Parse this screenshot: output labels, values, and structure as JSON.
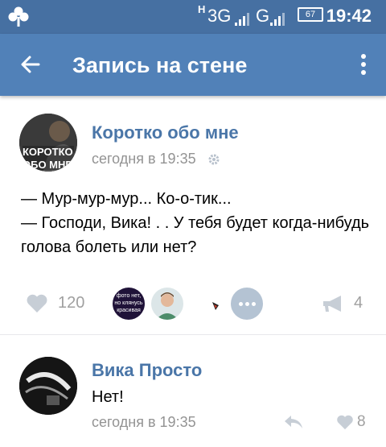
{
  "statusbar": {
    "network_h": "H",
    "network_3g": "3G",
    "network_g": "G",
    "battery": "67",
    "time": "19:42"
  },
  "appbar": {
    "title": "Запись на стене"
  },
  "post": {
    "author": "Коротко обо мне",
    "avatar_text_line1": "КОРОТКО",
    "avatar_text_line2": "ОБО МНЕ",
    "time": "сегодня в 19:35",
    "lines": [
      "— Мур-мур-мур... Ко-о-тик...",
      "— Господи, Вика! . . У тебя будет когда-нибудь",
      "голова болеть или нет?"
    ],
    "likes": "120",
    "shares": "4",
    "likers_badge_text": [
      "фото нет,",
      "но клянусь",
      "красивая"
    ]
  },
  "comment": {
    "author": "Вика Просто",
    "text": "Нет!",
    "time": "сегодня в 19:35",
    "likes": "8"
  },
  "colors": {
    "statusbar": "#4670a2",
    "appbar": "#5181b8",
    "link": "#4a76a8",
    "muted": "#939393",
    "icon_muted": "#b8c1cc"
  },
  "icons": [
    "clover-icon",
    "back-arrow-icon",
    "more-vert-icon",
    "gear-icon",
    "heart-icon",
    "megaphone-icon",
    "reply-icon"
  ]
}
